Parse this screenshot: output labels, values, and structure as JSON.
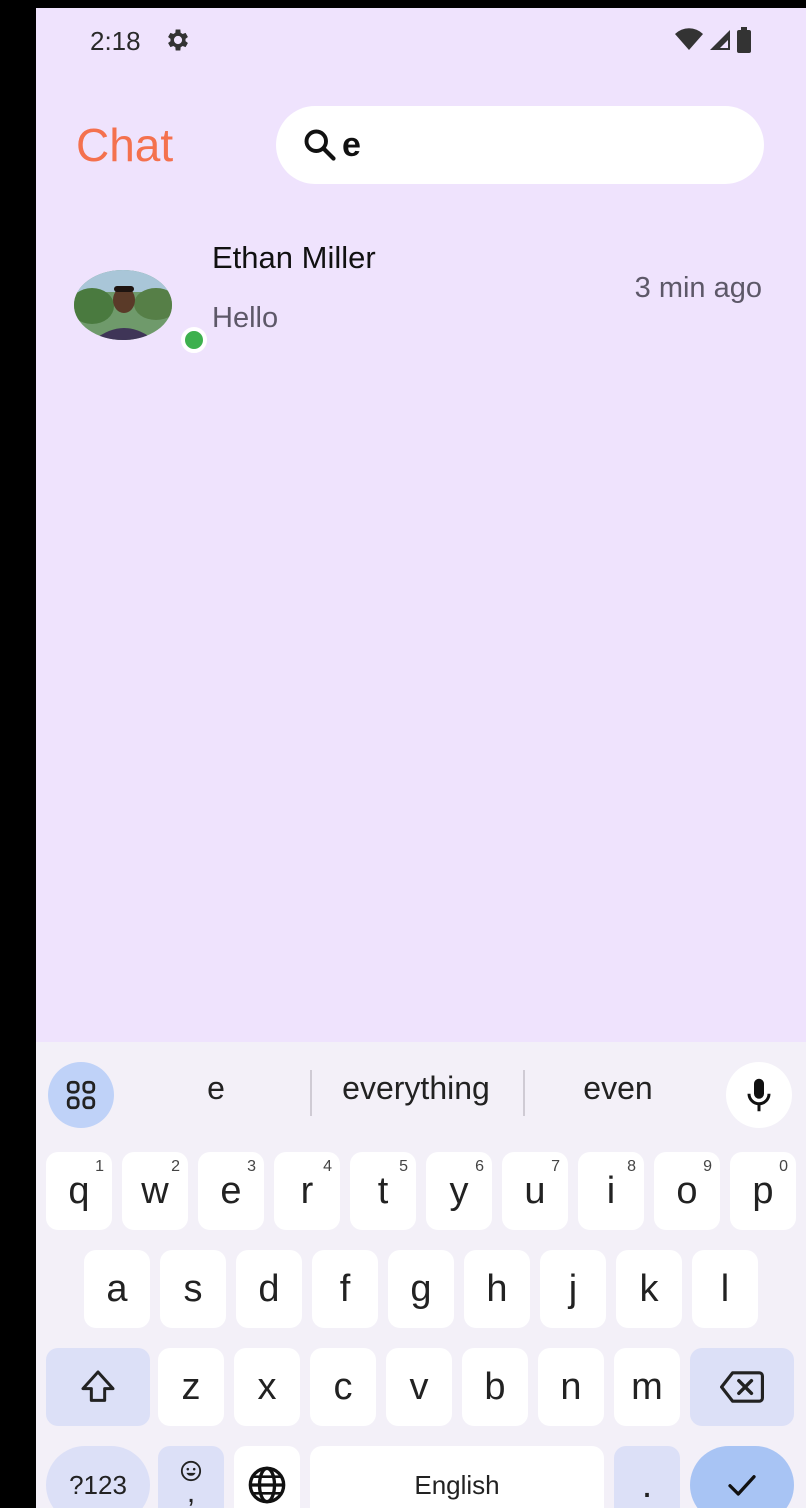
{
  "status_bar": {
    "time": "2:18",
    "icons": [
      "gear-icon",
      "wifi-icon",
      "signal-icon",
      "battery-icon"
    ]
  },
  "header": {
    "title": "Chat",
    "search_value": "e"
  },
  "chats": [
    {
      "name": "Ethan Miller",
      "message": "Hello",
      "time": "3 min ago",
      "online": true
    }
  ],
  "keyboard": {
    "suggestions": [
      "e",
      "everything",
      "even"
    ],
    "row1": [
      {
        "label": "q",
        "sup": "1"
      },
      {
        "label": "w",
        "sup": "2"
      },
      {
        "label": "e",
        "sup": "3"
      },
      {
        "label": "r",
        "sup": "4"
      },
      {
        "label": "t",
        "sup": "5"
      },
      {
        "label": "y",
        "sup": "6"
      },
      {
        "label": "u",
        "sup": "7"
      },
      {
        "label": "i",
        "sup": "8"
      },
      {
        "label": "o",
        "sup": "9"
      },
      {
        "label": "p",
        "sup": "0"
      }
    ],
    "row2": [
      "a",
      "s",
      "d",
      "f",
      "g",
      "h",
      "j",
      "k",
      "l"
    ],
    "row3": [
      "z",
      "x",
      "c",
      "v",
      "b",
      "n",
      "m"
    ],
    "symbols_label": "?123",
    "emoji_comma": ",",
    "space_label": "English",
    "period_label": "."
  },
  "colors": {
    "background": "#EFE3FD",
    "accent": "#F4714E",
    "online": "#3DB04E"
  }
}
